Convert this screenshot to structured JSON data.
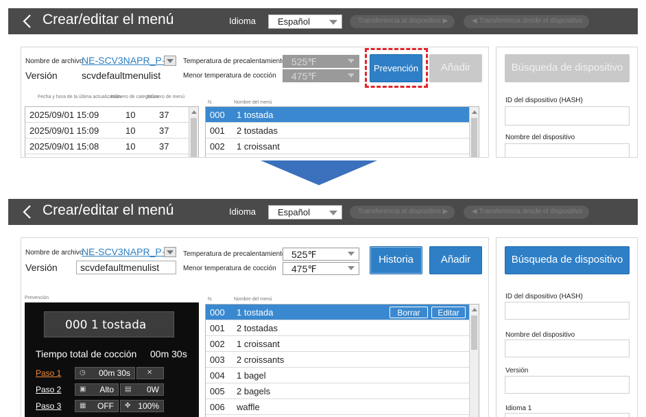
{
  "top": {
    "header": {
      "title": "Crear/editar el menú",
      "lang_label": "Idioma",
      "lang_value": "Español",
      "transfer_to": "Transferencia al dispositivo ▶",
      "transfer_from": "◀ Transferencia desde el dispositivo"
    },
    "file_label": "Nombre de archivo",
    "file_name": "NE-SCV3NAPR_P···",
    "version_label": "Versión",
    "version_value": "scvdefaultmenulist",
    "preheat_label": "Temperatura de precalentamiento",
    "preheat_value": "525℉",
    "min_temp_label": "Menor temperatura de cocción",
    "min_temp_value": "475℉",
    "preview_button": "Prevención",
    "add_button": "Añadir",
    "search_button": "Búsqueda de dispositivo",
    "history_headers": [
      "Fecha y hora de la última actualización",
      "Número de categorías",
      "Número de menú"
    ],
    "history_rows": [
      {
        "date": "2025/09/01 15:09",
        "cats": "10",
        "menus": "37"
      },
      {
        "date": "2025/09/01 15:09",
        "cats": "10",
        "menus": "37"
      },
      {
        "date": "2025/09/01 15:08",
        "cats": "10",
        "menus": "37"
      }
    ],
    "menu_headers": [
      "N.",
      "Nombre del menú"
    ],
    "menu_rows": [
      {
        "n": "000",
        "name": "1 tostada"
      },
      {
        "n": "001",
        "name": "2 tostadas"
      },
      {
        "n": "002",
        "name": "1 croissant"
      }
    ],
    "hash_label": "ID del dispositivo (HASH)",
    "device_name_label": "Nombre del dispositivo"
  },
  "bottom": {
    "header": {
      "title": "Crear/editar el menú",
      "lang_label": "Idioma",
      "lang_value": "Español",
      "transfer_to": "Transferencia al dispositivo ▶",
      "transfer_from": "◀ Transferencia desde el dispositivo"
    },
    "file_label": "Nombre de archivo",
    "file_name": "NE-SCV3NAPR_P···",
    "version_label": "Versión",
    "version_value": "scvdefaultmenulist",
    "preheat_label": "Temperatura de precalentamiento",
    "preheat_value": "525℉",
    "min_temp_label": "Menor temperatura de cocción",
    "min_temp_value": "475℉",
    "history_button": "Historia",
    "add_button": "Añadir",
    "search_button": "Búsqueda de dispositivo",
    "preview_label": "Prevención",
    "preview": {
      "menu_name": "000 1 tostada",
      "total_label": "Tiempo total de cocción",
      "total_value": "00m 30s",
      "steps": [
        {
          "label": "Paso 1",
          "value1": "00m 30s",
          "icon1": "clock-icon",
          "icon2": "mute-icon"
        },
        {
          "label": "Paso 2",
          "value1": "Alto",
          "value2": "0W",
          "icon1": "fan-box-icon",
          "icon2": "microwave-icon"
        },
        {
          "label": "Paso 3",
          "value1": "OFF",
          "value2": "100%",
          "icon1": "heater-icon",
          "icon2": "fan-icon"
        }
      ]
    },
    "menu_headers": [
      "N.",
      "Nombre del menú"
    ],
    "menu_rows": [
      {
        "n": "000",
        "name": "1 tostada"
      },
      {
        "n": "001",
        "name": "2 tostadas"
      },
      {
        "n": "002",
        "name": "1 croissant"
      },
      {
        "n": "003",
        "name": "2 croissants"
      },
      {
        "n": "004",
        "name": "1 bagel"
      },
      {
        "n": "005",
        "name": "2 bagels"
      },
      {
        "n": "006",
        "name": "waffle"
      }
    ],
    "delete_button": "Borrar",
    "edit_button": "Editar",
    "hash_label": "ID del dispositivo (HASH)",
    "device_name_label": "Nombre del dispositivo",
    "device_version_label": "Versión",
    "device_lang_label": "Idioma 1"
  },
  "colors": {
    "header_bg": "#4a4a4a",
    "accent": "#2f7fc6",
    "selected_row": "#3a89d0",
    "highlight_dash": "#e0242b",
    "arrow": "#3b70bd",
    "step1_color": "#f08a3c"
  }
}
